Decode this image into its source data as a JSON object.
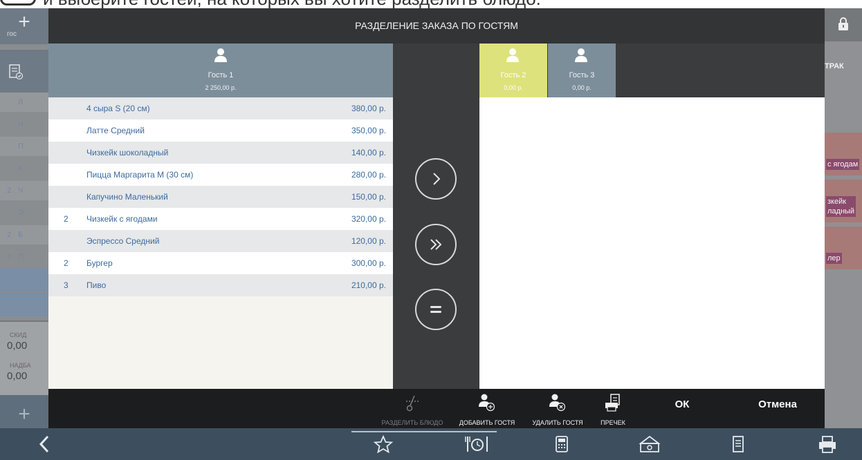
{
  "banner": {
    "text": "и выберите гостей, на которых вы хотите разделить блюдо."
  },
  "background": {
    "guest_button_label": "гос",
    "rows": [
      {
        "qty": "",
        "letter": "Л"
      },
      {
        "qty": "",
        "letter": "Ч"
      },
      {
        "qty": "",
        "letter": "П"
      },
      {
        "qty": "",
        "letter": "К"
      },
      {
        "qty": "2",
        "letter": "Ч"
      },
      {
        "qty": "",
        "letter": "Э"
      },
      {
        "qty": "2",
        "letter": "Б"
      },
      {
        "qty": "3",
        "letter": "П"
      }
    ],
    "discount_label": "СКИД",
    "discount_value": "0,00",
    "surcharge_label": "НАДБА",
    "surcharge_value": "0,00",
    "right_header": "ТРАК",
    "right_tiles": [
      "с ягодам",
      "зкейк\nладный",
      "лер"
    ]
  },
  "modal": {
    "title": "РАЗДЕЛЕНИЕ ЗАКАЗА ПО ГОСТЯМ",
    "source_guest": {
      "name": "Гость 1",
      "total": "2 250,00 р."
    },
    "items": [
      {
        "qty": "",
        "name": "4 сыра S (20 см)",
        "price": "380,00 р."
      },
      {
        "qty": "",
        "name": "Латте Средний",
        "price": "350,00 р."
      },
      {
        "qty": "",
        "name": "Чизкейк шоколадный",
        "price": "140,00 р."
      },
      {
        "qty": "",
        "name": "Пицца Маргарита М (30 см)",
        "price": "280,00 р."
      },
      {
        "qty": "",
        "name": "Капучино Маленький",
        "price": "150,00 р."
      },
      {
        "qty": "2",
        "name": "Чизкейк с ягодами",
        "price": "320,00 р."
      },
      {
        "qty": "",
        "name": "Эспрессо Средний",
        "price": "120,00 р."
      },
      {
        "qty": "2",
        "name": "Бургер",
        "price": "300,00 р."
      },
      {
        "qty": "3",
        "name": "Пиво",
        "price": "210,00 р."
      }
    ],
    "target_guests": [
      {
        "name": "Гость 2",
        "total": "0,00 р.",
        "selected": true
      },
      {
        "name": "Гость 3",
        "total": "0,00 р.",
        "selected": false
      }
    ],
    "toolbar": {
      "split_dish": "РАЗДЕЛИТЬ БЛЮДО",
      "add_guest": "ДОБАВИТЬ ГОСТЯ",
      "remove_guest": "УДАЛИТЬ ГОСТЯ",
      "precheck": "ПРЕЧЕК",
      "ok": "ОК",
      "cancel": "Отмена"
    }
  },
  "colors": {
    "guest_header": "#7d8e9b",
    "selected_guest": "#dde27c",
    "item_text": "#3d6a9e"
  }
}
